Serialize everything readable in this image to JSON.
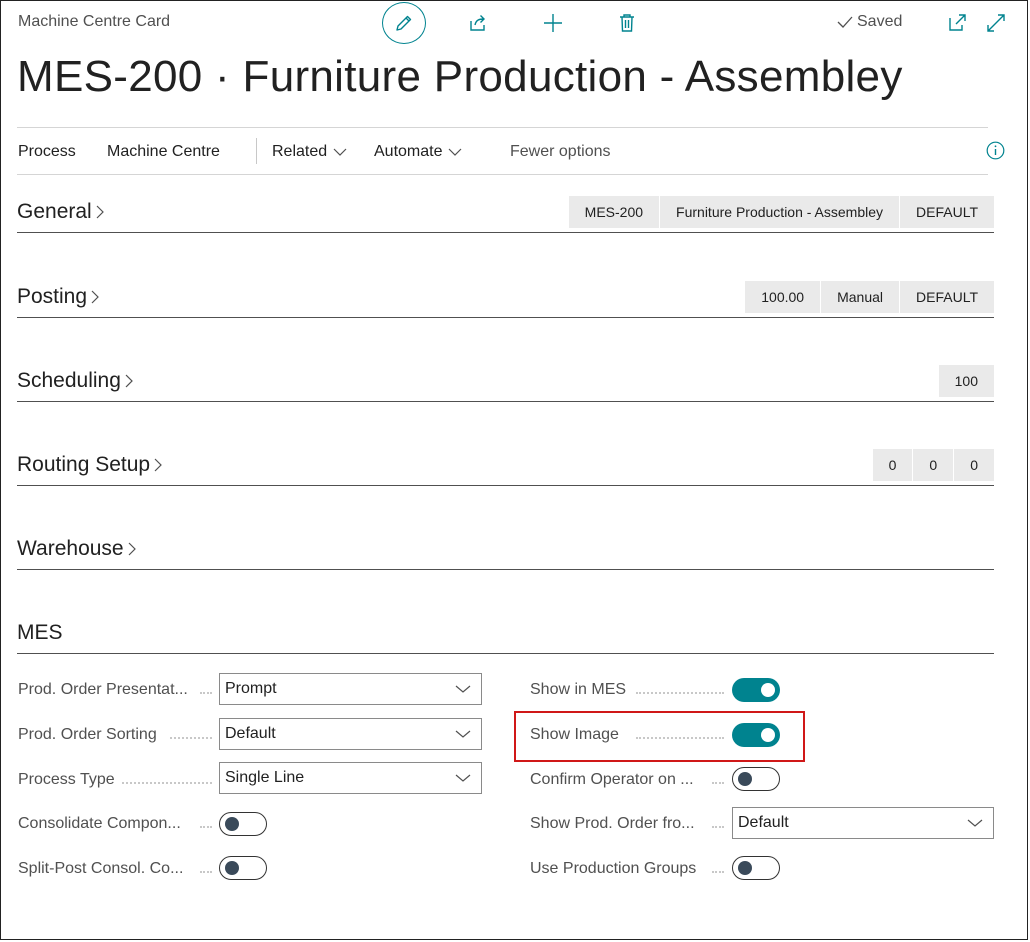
{
  "header": {
    "caption": "Machine Centre Card",
    "saved_label": "Saved",
    "title": "MES-200 · Furniture Production - Assembley"
  },
  "toolbar_icons": [
    "pencil-icon",
    "share-icon",
    "plus-icon",
    "trash-icon",
    "open-new-window-icon",
    "expand-icon"
  ],
  "actions": {
    "process": "Process",
    "machine_centre": "Machine Centre",
    "related": "Related",
    "automate": "Automate",
    "fewer_options": "Fewer options"
  },
  "fasttabs": {
    "general": {
      "title": "General",
      "chips": [
        "MES-200",
        "Furniture Production - Assembley",
        "DEFAULT"
      ]
    },
    "posting": {
      "title": "Posting",
      "chips": [
        "100.00",
        "Manual",
        "DEFAULT"
      ]
    },
    "scheduling": {
      "title": "Scheduling",
      "chips": [
        "100"
      ]
    },
    "routing": {
      "title": "Routing Setup",
      "chips": [
        "0",
        "0",
        "0"
      ]
    },
    "warehouse": {
      "title": "Warehouse"
    }
  },
  "mes": {
    "title": "MES",
    "left": {
      "prod_order_presentation": {
        "label": "Prod. Order Presentat...",
        "value": "Prompt"
      },
      "prod_order_sorting": {
        "label": "Prod. Order Sorting",
        "value": "Default"
      },
      "process_type": {
        "label": "Process Type",
        "value": "Single Line"
      },
      "consolidate_components": {
        "label": "Consolidate Compon...",
        "checked": false
      },
      "split_post": {
        "label": "Split-Post Consol. Co...",
        "checked": false
      }
    },
    "right": {
      "show_in_mes": {
        "label": "Show in MES",
        "checked": true
      },
      "show_image": {
        "label": "Show Image",
        "checked": true
      },
      "confirm_operator": {
        "label": "Confirm Operator on ...",
        "checked": false
      },
      "show_prod_order_from": {
        "label": "Show Prod. Order fro...",
        "value": "Default"
      },
      "use_production_groups": {
        "label": "Use Production Groups",
        "checked": false
      }
    }
  },
  "colors": {
    "accent": "#00838f",
    "highlight": "#d01818"
  }
}
